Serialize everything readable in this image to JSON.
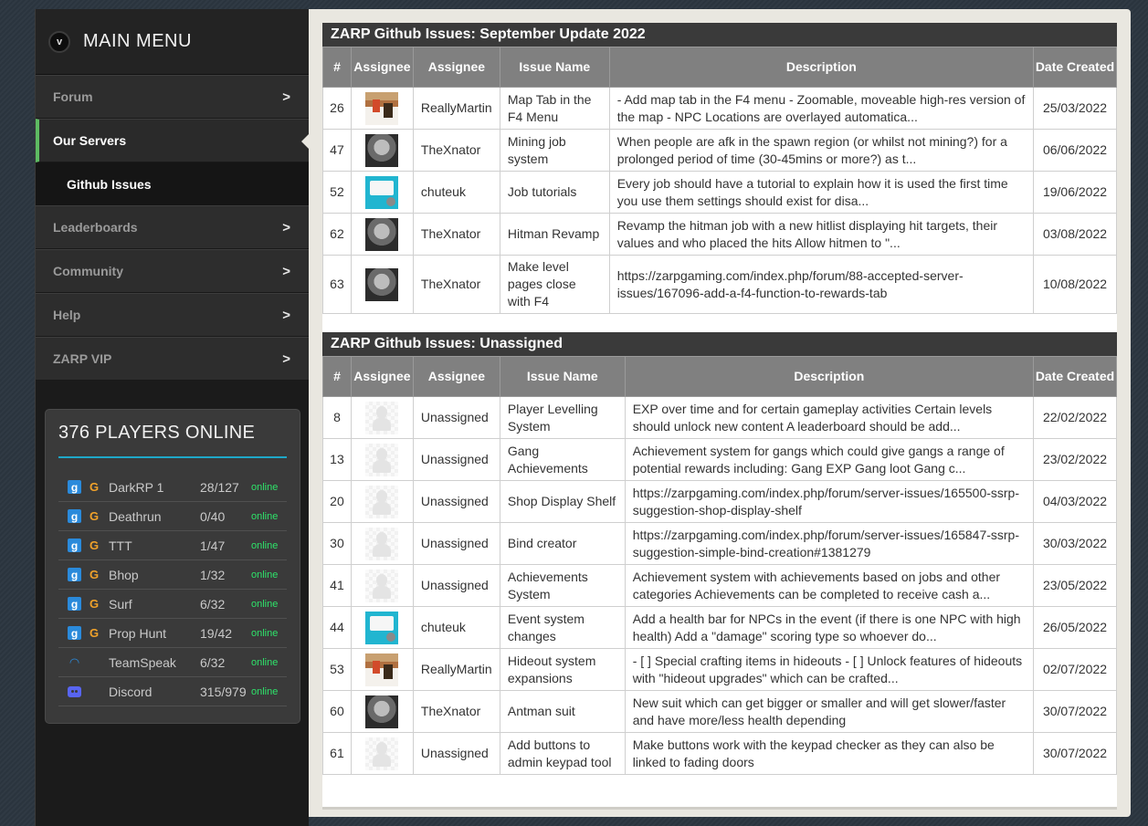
{
  "menu": {
    "toggle_label": "v",
    "title": "MAIN MENU",
    "items": [
      {
        "label": "Forum",
        "arrow": ">"
      },
      {
        "label": "Our Servers",
        "active": true
      },
      {
        "label": "Leaderboards",
        "arrow": ">"
      },
      {
        "label": "Community",
        "arrow": ">"
      },
      {
        "label": "Help",
        "arrow": ">"
      },
      {
        "label": "ZARP VIP",
        "arrow": ">"
      }
    ],
    "sub_item": "Github Issues"
  },
  "players": {
    "title": "376 PLAYERS ONLINE",
    "servers": [
      {
        "name": "DarkRP 1",
        "count": "28/127",
        "status": "online",
        "icon": "gmod"
      },
      {
        "name": "Deathrun",
        "count": "0/40",
        "status": "online",
        "icon": "gmod"
      },
      {
        "name": "TTT",
        "count": "1/47",
        "status": "online",
        "icon": "gmod"
      },
      {
        "name": "Bhop",
        "count": "1/32",
        "status": "online",
        "icon": "gmod"
      },
      {
        "name": "Surf",
        "count": "6/32",
        "status": "online",
        "icon": "gmod"
      },
      {
        "name": "Prop Hunt",
        "count": "19/42",
        "status": "online",
        "icon": "gmod"
      },
      {
        "name": "TeamSpeak",
        "count": "6/32",
        "status": "online",
        "icon": "teamspeak"
      },
      {
        "name": "Discord",
        "count": "315/979",
        "status": "online",
        "icon": "discord"
      }
    ]
  },
  "colors": {
    "accent_blue": "#1ea7c8",
    "online_green": "#2ee36a",
    "active_bar": "#5dbb63"
  },
  "tables": [
    {
      "title": "ZARP Github Issues: September Update 2022",
      "headers": {
        "num": "#",
        "assignee_img": "Assignee",
        "assignee": "Assignee",
        "issue": "Issue Name",
        "desc": "Description",
        "date": "Date Created"
      },
      "rows": [
        {
          "num": "26",
          "avatar": "reallymartin",
          "assignee": "ReallyMartin",
          "issue": "Map Tab in the F4 Menu",
          "desc": "- Add map tab in the F4 menu - Zoomable, moveable high-res version of the map - NPC Locations are overlayed automatica...",
          "date": "25/03/2022"
        },
        {
          "num": "47",
          "avatar": "thexnator",
          "assignee": "TheXnator",
          "issue": "Mining job system",
          "desc": "When people are afk in the spawn region (or whilst not mining?) for a prolonged period of time (30-45mins or more?) as t...",
          "date": "06/06/2022"
        },
        {
          "num": "52",
          "avatar": "chuteuk",
          "assignee": "chuteuk",
          "issue": "Job tutorials",
          "desc": "Every job should have a tutorial to explain how it is used the first time you use them settings should exist for disa...",
          "date": "19/06/2022"
        },
        {
          "num": "62",
          "avatar": "thexnator",
          "assignee": "TheXnator",
          "issue": "Hitman Revamp",
          "desc": "Revamp the hitman job with a new hitlist displaying hit targets, their values and who placed the hits Allow hitmen to \"...",
          "date": "03/08/2022"
        },
        {
          "num": "63",
          "avatar": "thexnator",
          "assignee": "TheXnator",
          "issue": "Make level pages close with F4",
          "desc": "https://zarpgaming.com/index.php/forum/88-accepted-server-issues/167096-add-a-f4-function-to-rewards-tab",
          "date": "10/08/2022"
        }
      ]
    },
    {
      "title": "ZARP Github Issues: Unassigned",
      "headers": {
        "num": "#",
        "assignee_img": "Assignee",
        "assignee": "Assignee",
        "issue": "Issue Name",
        "desc": "Description",
        "date": "Date Created"
      },
      "rows": [
        {
          "num": "8",
          "avatar": "unassigned",
          "assignee": "Unassigned",
          "issue": "Player Levelling System",
          "desc": "EXP over time and for certain gameplay activities Certain levels should unlock new content A leaderboard should be add...",
          "date": "22/02/2022"
        },
        {
          "num": "13",
          "avatar": "unassigned",
          "assignee": "Unassigned",
          "issue": "Gang Achievements",
          "desc": "Achievement system for gangs which could give gangs a range of potential rewards including: Gang EXP Gang loot Gang c...",
          "date": "23/02/2022"
        },
        {
          "num": "20",
          "avatar": "unassigned",
          "assignee": "Unassigned",
          "issue": "Shop Display Shelf",
          "desc": "https://zarpgaming.com/index.php/forum/server-issues/165500-ssrp-suggestion-shop-display-shelf",
          "date": "04/03/2022"
        },
        {
          "num": "30",
          "avatar": "unassigned",
          "assignee": "Unassigned",
          "issue": "Bind creator",
          "desc": "https://zarpgaming.com/index.php/forum/server-issues/165847-ssrp-suggestion-simple-bind-creation#1381279",
          "date": "30/03/2022"
        },
        {
          "num": "41",
          "avatar": "unassigned",
          "assignee": "Unassigned",
          "issue": "Achievements System",
          "desc": "Achievement system with achievements based on jobs and other categories Achievements can be completed to receive cash a...",
          "date": "23/05/2022"
        },
        {
          "num": "44",
          "avatar": "chuteuk",
          "assignee": "chuteuk",
          "issue": "Event system changes",
          "desc": "Add a health bar for NPCs in the event (if there is one NPC with high health) Add a \"damage\" scoring type so whoever do...",
          "date": "26/05/2022"
        },
        {
          "num": "53",
          "avatar": "reallymartin",
          "assignee": "ReallyMartin",
          "issue": "Hideout system expansions",
          "desc": "- [ ] Special crafting items in hideouts - [ ] Unlock features of hideouts with \"hideout upgrades\" which can be crafted...",
          "date": "02/07/2022"
        },
        {
          "num": "60",
          "avatar": "thexnator",
          "assignee": "TheXnator",
          "issue": "Antman suit",
          "desc": "New suit which can get bigger or smaller and will get slower/faster and have more/less health depending",
          "date": "30/07/2022"
        },
        {
          "num": "61",
          "avatar": "unassigned",
          "assignee": "Unassigned",
          "issue": "Add buttons to admin keypad tool",
          "desc": "Make buttons work with the keypad checker as they can also be linked to fading doors",
          "date": "30/07/2022"
        }
      ]
    }
  ]
}
